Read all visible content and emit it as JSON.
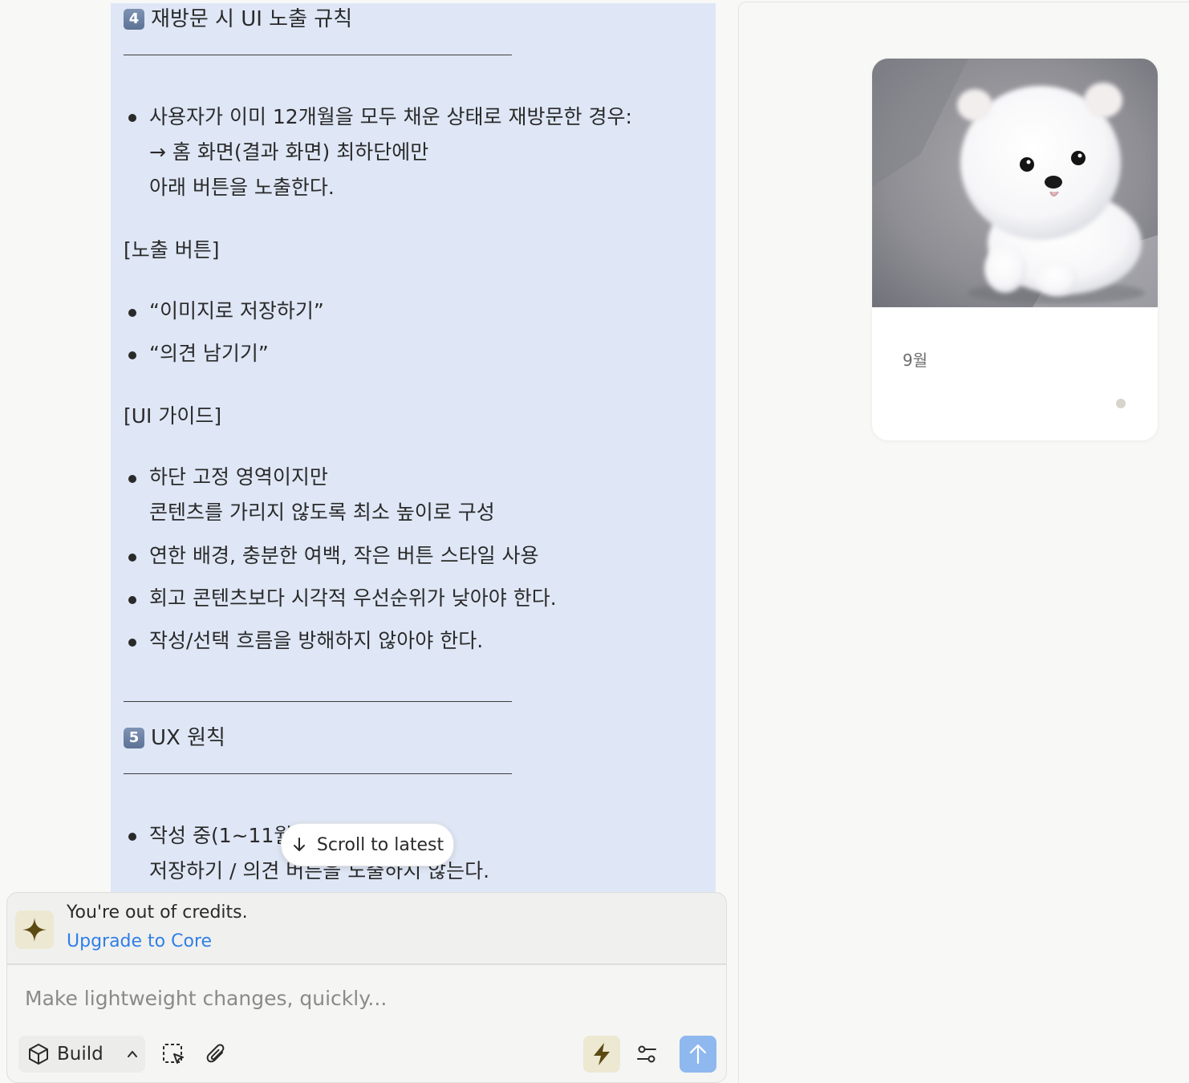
{
  "chat": {
    "section4_number": "4",
    "section4_title": "재방문 시 UI 노출 규칙",
    "revisit_bullet_line1": "사용자가 이미 12개월을 모두 채운 상태로 재방문한 경우:",
    "revisit_bullet_line2": "→ 홈 화면(결과 화면) 최하단에만",
    "revisit_bullet_line3": "아래 버튼을 노출한다.",
    "exposed_buttons_heading": "[노출 버튼]",
    "exposed_buttons": [
      "“이미지로 저장하기”",
      "“의견 남기기”"
    ],
    "ui_guide_heading": "[UI 가이드]",
    "ui_guide_item1_line1": "하단 고정 영역이지만",
    "ui_guide_item1_line2": "콘텐츠를 가리지 않도록 최소 높이로 구성",
    "ui_guide_item2": "연한 배경, 충분한 여백, 작은 버튼 스타일 사용",
    "ui_guide_item3": "회고 콘텐츠보다 시각적 우선순위가 낮아야 한다.",
    "ui_guide_item4": "작성/선택 흐름을 방해하지 않아야 한다.",
    "section5_number": "5",
    "section5_title": "UX 원칙",
    "ux_item1_line1": "작성 중(1~11월",
    "ux_item1_line2": "저장하기 / 의견 버튼을 노출하지 않는다."
  },
  "scroll_to_latest": {
    "label": "Scroll to latest",
    "icon": "arrow-down-icon"
  },
  "credits_banner": {
    "message": "You're out of credits.",
    "upgrade_label": "Upgrade to Core",
    "icon": "sparkle-icon",
    "accent_color": "#2f7fe6"
  },
  "composer": {
    "placeholder": "Make lightweight changes, quickly...",
    "mode_label": "Build",
    "icons": [
      "cube-icon",
      "chevron-up-icon",
      "select-area-icon",
      "paperclip-icon",
      "lightning-icon",
      "settings-sliders-icon",
      "arrow-up-icon"
    ]
  },
  "preview": {
    "card_month": "9월",
    "image_subject": "white fluffy puppy"
  }
}
